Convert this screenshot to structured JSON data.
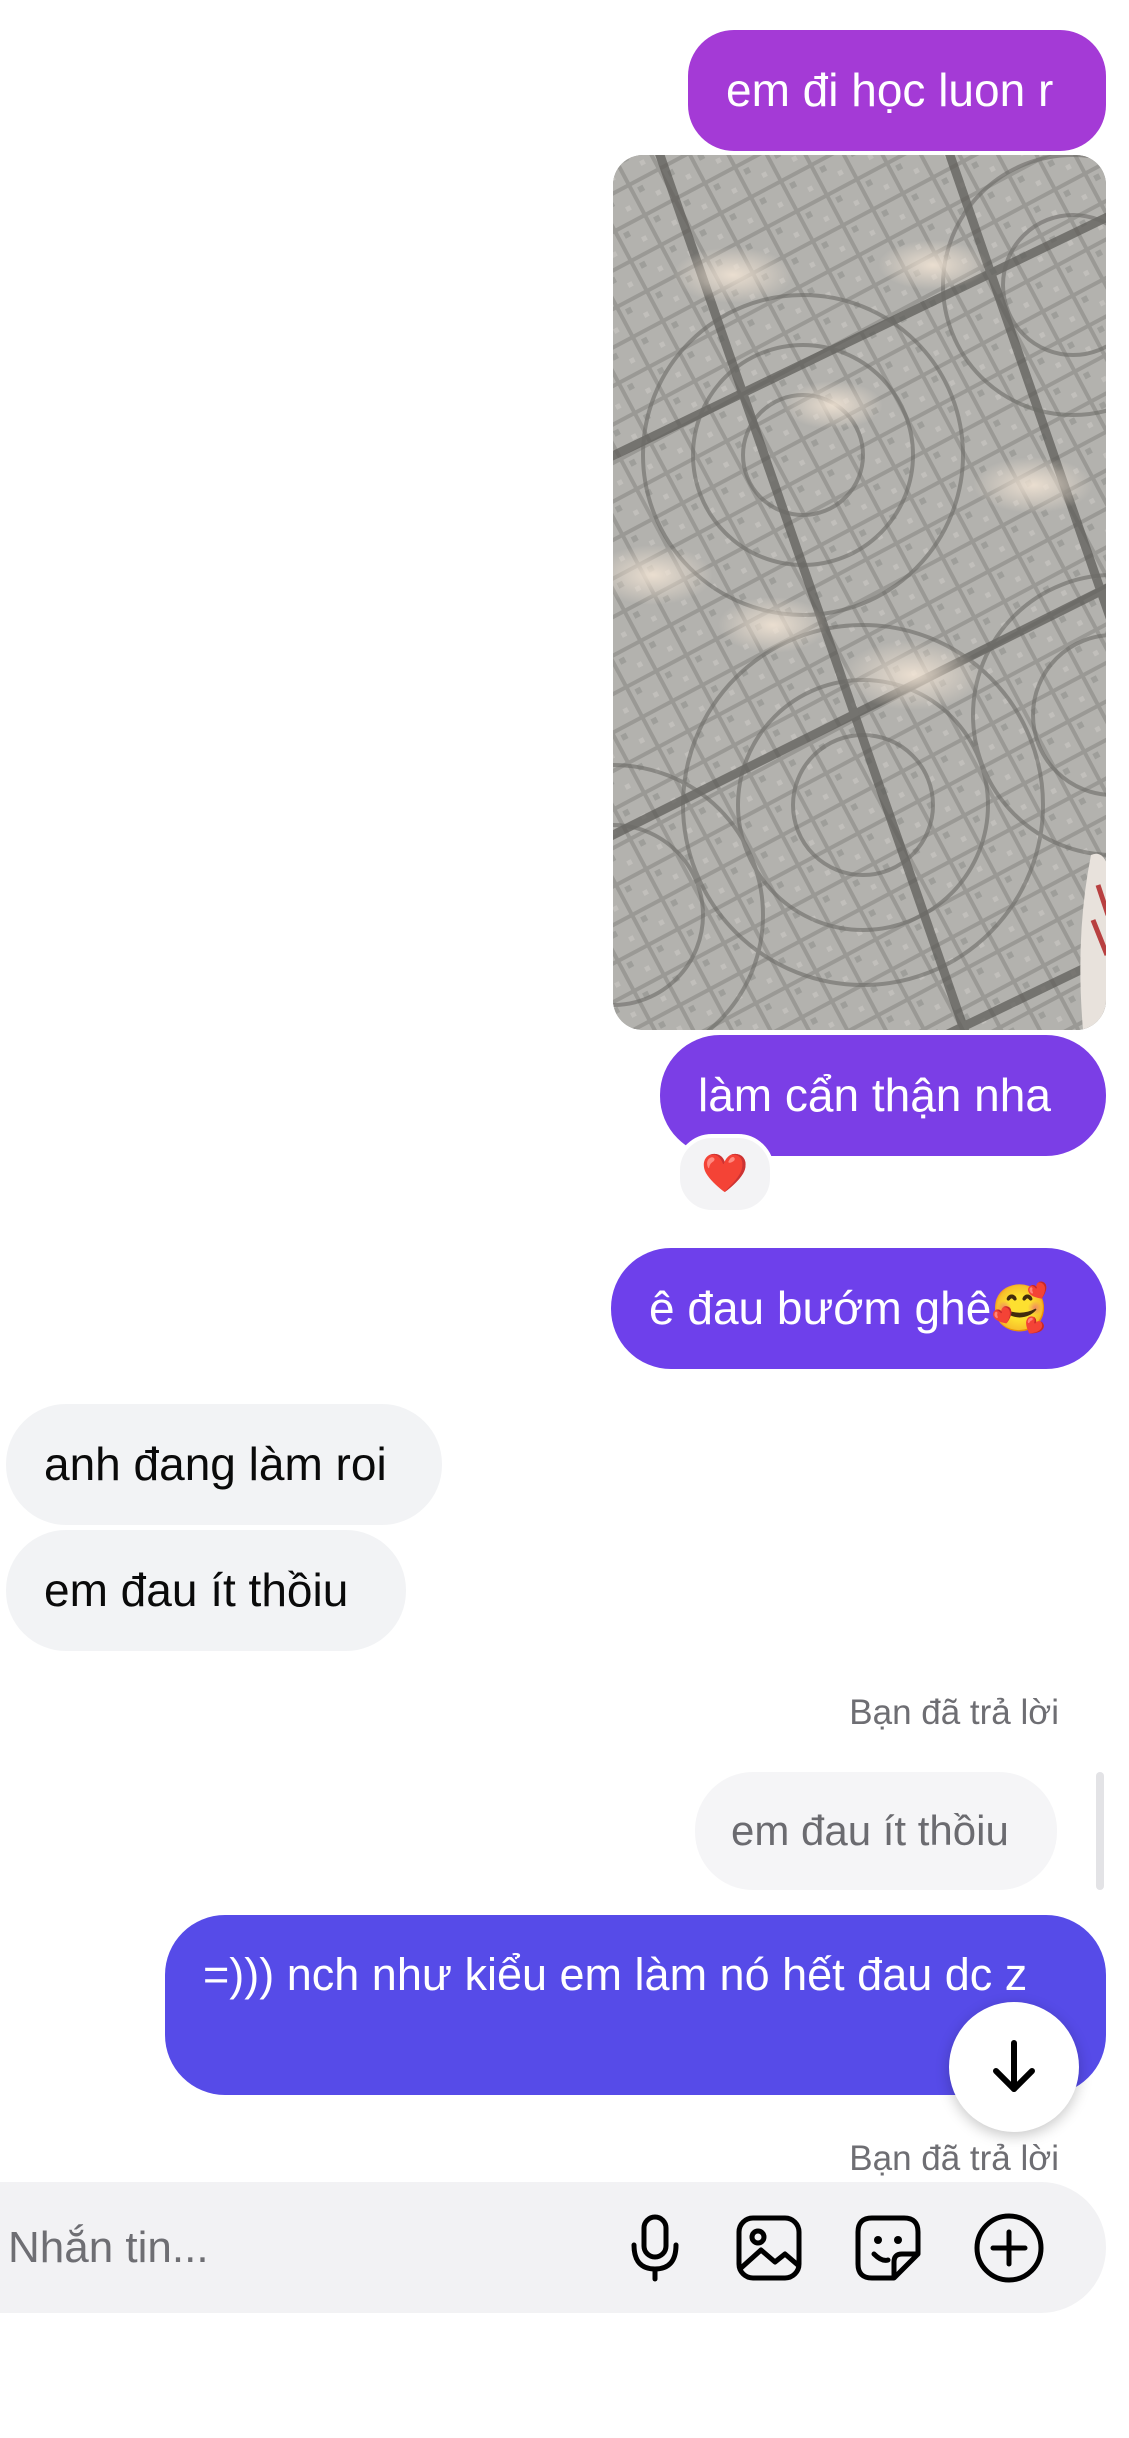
{
  "messages": {
    "out1": "em đi học luon r",
    "out2": "làm cẩn thận nha",
    "out2_reaction": "❤️",
    "out3": "ê đau bướm ghê🥰",
    "in1": "anh đang làm roi",
    "in2": "em đau ít thồiu",
    "reply_label_1": "Bạn đã trả lời",
    "quoted": "em đau ít thồiu",
    "out4": "=))) nch như kiểu em làm nó hết đau dc z",
    "reply_label_2": "Bạn đã trả lời"
  },
  "composer": {
    "placeholder": "Nhắn tin..."
  },
  "colors": {
    "bubble_purple": "#a43ad6",
    "bubble_violet": "#6e40eb",
    "bubble_indigo": "#564be8",
    "incoming_gray": "#f2f3f5"
  },
  "icons": [
    "microphone-icon",
    "image-icon",
    "sticker-icon",
    "plus-circle-icon",
    "arrow-down-icon"
  ]
}
